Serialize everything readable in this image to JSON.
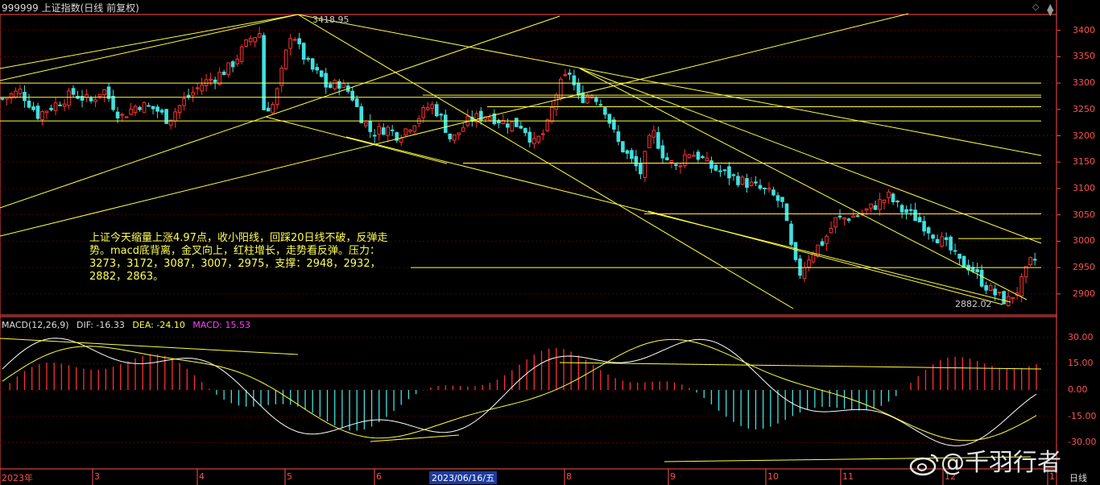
{
  "window": {
    "title": "999999 上证指数(日线 前复权)",
    "controls": [
      "◇",
      "▲",
      "▼"
    ]
  },
  "note": "上证今天缩量上涨4.97点，收小阳线，回踩20日线不破，反弹走势。macd底背离，金叉向上，红柱增长，走势看反弹。压力：3273，3172，3087，3007，2975，支撑：2948，2932，2882，2863。",
  "annotations": {
    "high": "3418.95",
    "low": "2882.02"
  },
  "macd_legend": {
    "name": "MACD(12,26,9)",
    "dif_label": "DIF: -16.33",
    "dea_label": "DEA: -24.10",
    "macd_label": "MACD: 15.53"
  },
  "x_axis": {
    "months": [
      "2023年",
      "3",
      "4",
      "5",
      "6",
      "8",
      "9",
      "10",
      "11",
      "12",
      "1"
    ],
    "cursor_date": "2023/06/16/五",
    "period": "日线"
  },
  "watermark": "@千羽行者",
  "colors": {
    "up": "#ff3030",
    "down": "#40e0e0",
    "line": "#ffff40",
    "axis": "#ff5050",
    "grid": "#5a0000"
  },
  "chart_data": [
    {
      "type": "candlestick",
      "title": "999999 上证指数(日线 前复权)",
      "ylim": [
        2860,
        3430
      ],
      "y_ticks": [
        2900,
        2950,
        3000,
        3050,
        3100,
        3150,
        3200,
        3250,
        3300,
        3350,
        3400
      ],
      "close_path": [
        [
          0,
          3270
        ],
        [
          6,
          3285
        ],
        [
          12,
          3240
        ],
        [
          18,
          3260
        ],
        [
          24,
          3280
        ],
        [
          30,
          3265
        ],
        [
          34,
          3290
        ],
        [
          40,
          3235
        ],
        [
          46,
          3260
        ],
        [
          52,
          3250
        ],
        [
          56,
          3230
        ],
        [
          62,
          3270
        ],
        [
          68,
          3300
        ],
        [
          73,
          3315
        ],
        [
          77,
          3330
        ],
        [
          84,
          3385
        ],
        [
          87,
          3395
        ],
        [
          88,
          3250
        ],
        [
          92,
          3260
        ],
        [
          97,
          3380
        ],
        [
          98,
          3405
        ],
        [
          100,
          3370
        ],
        [
          104,
          3330
        ],
        [
          108,
          3310
        ],
        [
          110,
          3290
        ],
        [
          114,
          3300
        ],
        [
          118,
          3280
        ],
        [
          121,
          3240
        ],
        [
          125,
          3205
        ],
        [
          130,
          3215
        ],
        [
          134,
          3200
        ],
        [
          140,
          3230
        ],
        [
          145,
          3260
        ],
        [
          148,
          3240
        ],
        [
          152,
          3190
        ],
        [
          158,
          3230
        ],
        [
          164,
          3240
        ],
        [
          170,
          3225
        ],
        [
          176,
          3220
        ],
        [
          180,
          3185
        ],
        [
          184,
          3210
        ],
        [
          188,
          3290
        ],
        [
          192,
          3320
        ],
        [
          195,
          3270
        ],
        [
          200,
          3280
        ],
        [
          204,
          3250
        ],
        [
          208,
          3190
        ],
        [
          212,
          3160
        ],
        [
          216,
          3130
        ],
        [
          220,
          3210
        ],
        [
          224,
          3160
        ],
        [
          228,
          3140
        ],
        [
          232,
          3170
        ],
        [
          236,
          3160
        ],
        [
          240,
          3140
        ],
        [
          244,
          3130
        ],
        [
          248,
          3120
        ],
        [
          252,
          3110
        ],
        [
          256,
          3100
        ],
        [
          260,
          3090
        ],
        [
          264,
          3070
        ],
        [
          268,
          2960
        ],
        [
          270,
          2940
        ],
        [
          274,
          2980
        ],
        [
          278,
          3000
        ],
        [
          282,
          3040
        ],
        [
          286,
          3045
        ],
        [
          290,
          3050
        ],
        [
          296,
          3070
        ],
        [
          300,
          3085
        ],
        [
          304,
          3060
        ],
        [
          308,
          3050
        ],
        [
          312,
          3030
        ],
        [
          316,
          3010
        ],
        [
          320,
          2990
        ],
        [
          324,
          2960
        ],
        [
          328,
          2950
        ],
        [
          332,
          2920
        ],
        [
          336,
          2900
        ],
        [
          340,
          2885
        ],
        [
          344,
          2910
        ],
        [
          348,
          2960
        ],
        [
          350,
          2965
        ]
      ],
      "high": 3418.95,
      "low": 2882.02
    },
    {
      "type": "bar",
      "title": "MACD(12,26,9)",
      "ylim": [
        -45,
        40
      ],
      "y_ticks": [
        30,
        15,
        0,
        -15,
        -30
      ],
      "series": [
        {
          "name": "DIF",
          "last": -16.33
        },
        {
          "name": "DEA",
          "last": -24.1
        },
        {
          "name": "MACD",
          "last": 15.53
        }
      ]
    }
  ]
}
